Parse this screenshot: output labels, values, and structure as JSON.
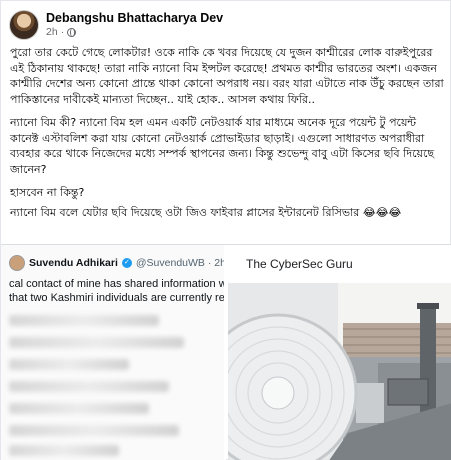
{
  "post": {
    "author": "Debangshu Bhattacharya Dev",
    "time": "2h",
    "privacy_icon": "globe-icon",
    "paragraphs": [
      "পুরো তার কেটে গেছে লোকটার! ওকে নাকি কে খবর দিয়েছে যে দুজন কাশ্মীরের লোক বারুইপুরের এই ঠিকানায় থাকছে! তারা নাকি ন্যানো বিম ইন্সটল করেছে! প্রথমত কাশ্মীর ভারতের অংশ। একজন কাশ্মীরি দেশের অন্য কোনো প্রান্তে থাকা কোনো অপরাধ নয়। বরং যারা এটাতে নাক উঁচু করছেন তারা পাকিস্তানের দাবীকেই মান্যতা দিচ্ছেন.. যাই হোক.. আসল কথায় ফিরি..",
      "ন্যানো বিম কী? ন্যানো বিম হল এমন একটি নেটওয়ার্ক যার মাধ্যমে অনেক দূরে পয়েন্ট টু পয়েন্ট কানেক্ট এস্টাবলিশ করা যায় কোনো নেটওয়ার্ক প্রোভাইডার ছাড়াই। এগুলো সাধারণত অপরাধীরা ব্যবহার করে থাকে নিজেদের মধ্যে সম্পর্ক স্থাপনের জন্য। কিন্তু শুভেন্দু বাবু এটা কিসের ছবি দিয়েছে জানেন?",
      "হাসবেন না কিন্তু?",
      "ন্যানো বিম বলে যেটার ছবি দিয়েছে ওটা জিও ফাইবার প্লাসের ইন্টারনেট রিসিভার 😂😂😂"
    ]
  },
  "tweet": {
    "name": "Suvendu Adhikari",
    "verified_icon": "verified-badge-icon",
    "handle": "@SuvenduWB · 2h",
    "lines": [
      "cal contact of mine has shared information with",
      "that two Kashmiri individuals are currently residin"
    ]
  },
  "cybersec": {
    "title": "The CyberSec Guru"
  }
}
